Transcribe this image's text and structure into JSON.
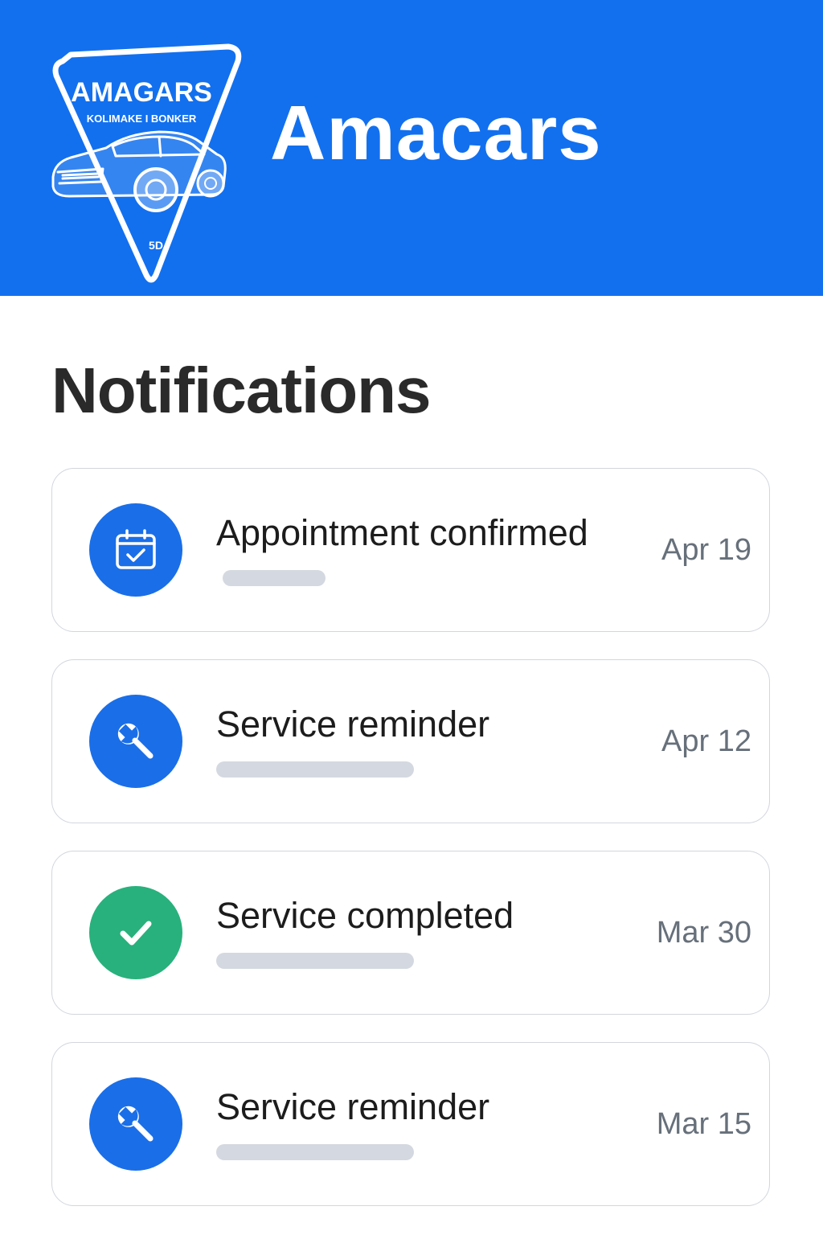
{
  "app": {
    "title": "Amacars",
    "logo_text": "AMAGARS",
    "logo_subtext": "KOLIMAKE I BONKER",
    "logo_badge": "5D"
  },
  "page": {
    "title": "Notifications"
  },
  "notifications": [
    {
      "title": "Appointment confirmed",
      "date": "Apr 19",
      "icon": "calendar-check-icon",
      "icon_color": "#1a6ee8"
    },
    {
      "title": "Service reminder",
      "date": "Apr 12",
      "icon": "wrench-icon",
      "icon_color": "#1a6ee8"
    },
    {
      "title": "Service completed",
      "date": "Mar 30",
      "icon": "checkmark-icon",
      "icon_color": "#28b17c"
    },
    {
      "title": "Service reminder",
      "date": "Mar 15",
      "icon": "wrench-icon",
      "icon_color": "#1a6ee8"
    }
  ],
  "colors": {
    "header_bg": "#1270ef",
    "primary": "#1a6ee8",
    "success": "#28b17c",
    "card_border": "#d2d6dd",
    "placeholder_bar": "#d4d8e0"
  }
}
